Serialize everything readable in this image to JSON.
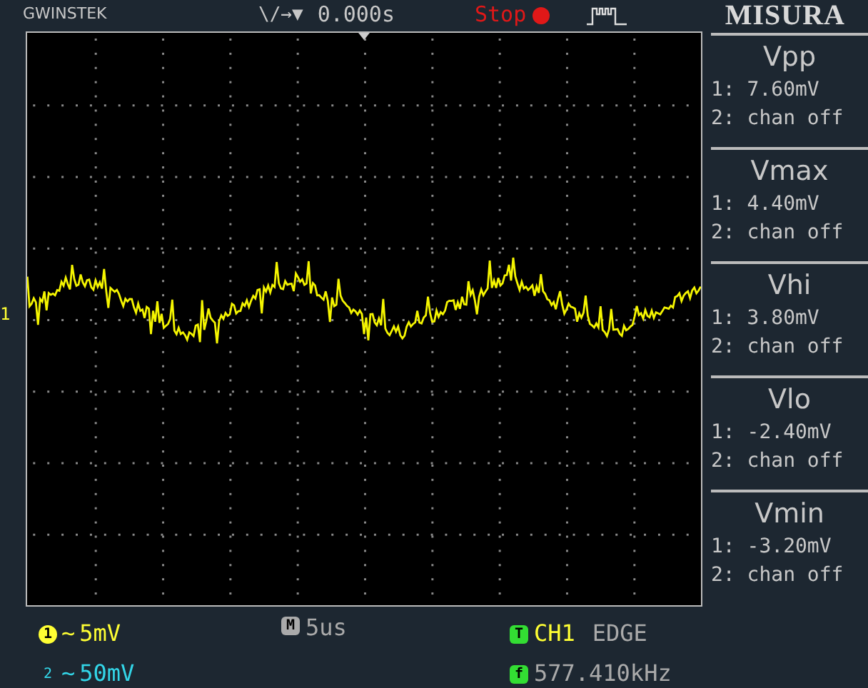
{
  "header": {
    "brand": "GWINSTEK",
    "trigger_symbols": "\\/→▼",
    "time_offset": "0.000s",
    "run_state": "Stop",
    "running": false,
    "panel_title": "MISURA"
  },
  "screen": {
    "channel_marker": "1"
  },
  "measurements": [
    {
      "name": "Vpp",
      "ch1": "1: 7.60mV",
      "ch2": "2: chan off"
    },
    {
      "name": "Vmax",
      "ch1": "1: 4.40mV",
      "ch2": "2: chan off"
    },
    {
      "name": "Vhi",
      "ch1": "1: 3.80mV",
      "ch2": "2: chan off"
    },
    {
      "name": "Vlo",
      "ch1": "1: -2.40mV",
      "ch2": "2: chan off"
    },
    {
      "name": "Vmin",
      "ch1": "1: -3.20mV",
      "ch2": "2: chan off"
    }
  ],
  "footer": {
    "ch1": {
      "badge": "1",
      "coupling": "~",
      "scale": "5mV"
    },
    "ch2": {
      "badge": "2",
      "coupling": "~",
      "scale": "50mV"
    },
    "timebase": {
      "badge": "M",
      "value": "5us"
    },
    "trigger": {
      "badge": "T",
      "source": "CH1",
      "mode": "EDGE"
    },
    "frequency": {
      "badge": "f",
      "value": "577.410kHz"
    }
  }
}
